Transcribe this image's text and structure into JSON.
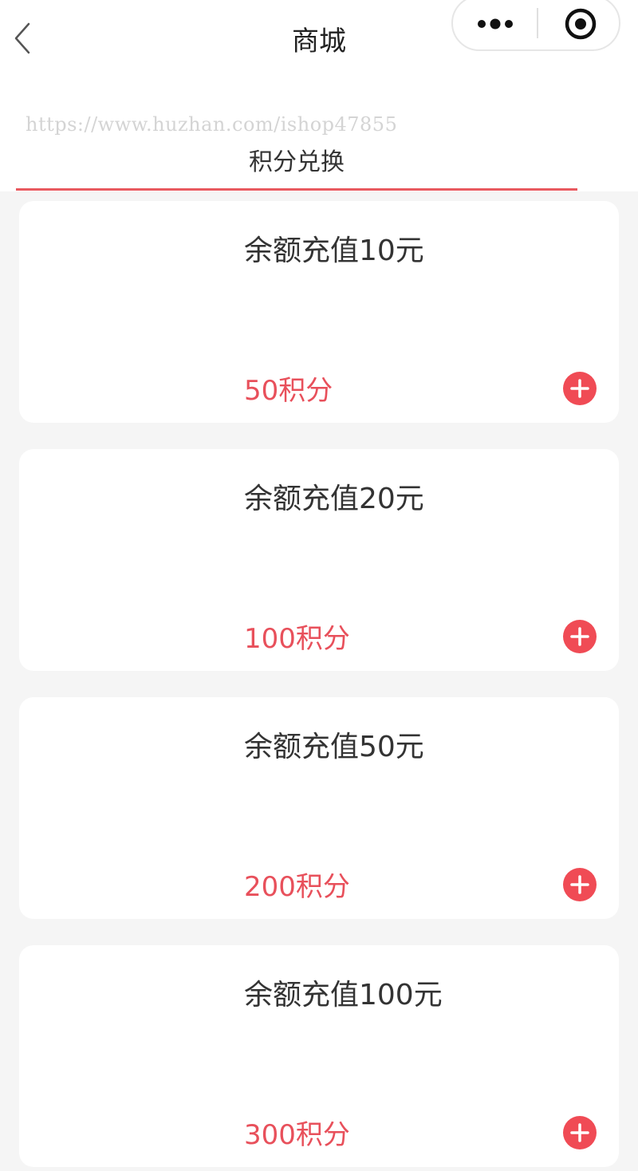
{
  "nav": {
    "title": "商城",
    "back_icon": "chevron-left-icon",
    "menu_icon": "more-dots-icon",
    "close_icon": "target-circle-icon"
  },
  "watermark": "https://www.huzhan.com/ishop47855",
  "tabs": [
    {
      "label": "积分兑换",
      "active": true
    }
  ],
  "colors": {
    "accent": "#e8505b",
    "add_button": "#f04b55",
    "background": "#f5f5f5"
  },
  "products": [
    {
      "title": "余额充值10元",
      "price": "50积分",
      "add_icon": "plus-circle-icon"
    },
    {
      "title": "余额充值20元",
      "price": "100积分",
      "add_icon": "plus-circle-icon"
    },
    {
      "title": "余额充值50元",
      "price": "200积分",
      "add_icon": "plus-circle-icon"
    },
    {
      "title": "余额充值100元",
      "price": "300积分",
      "add_icon": "plus-circle-icon"
    }
  ]
}
